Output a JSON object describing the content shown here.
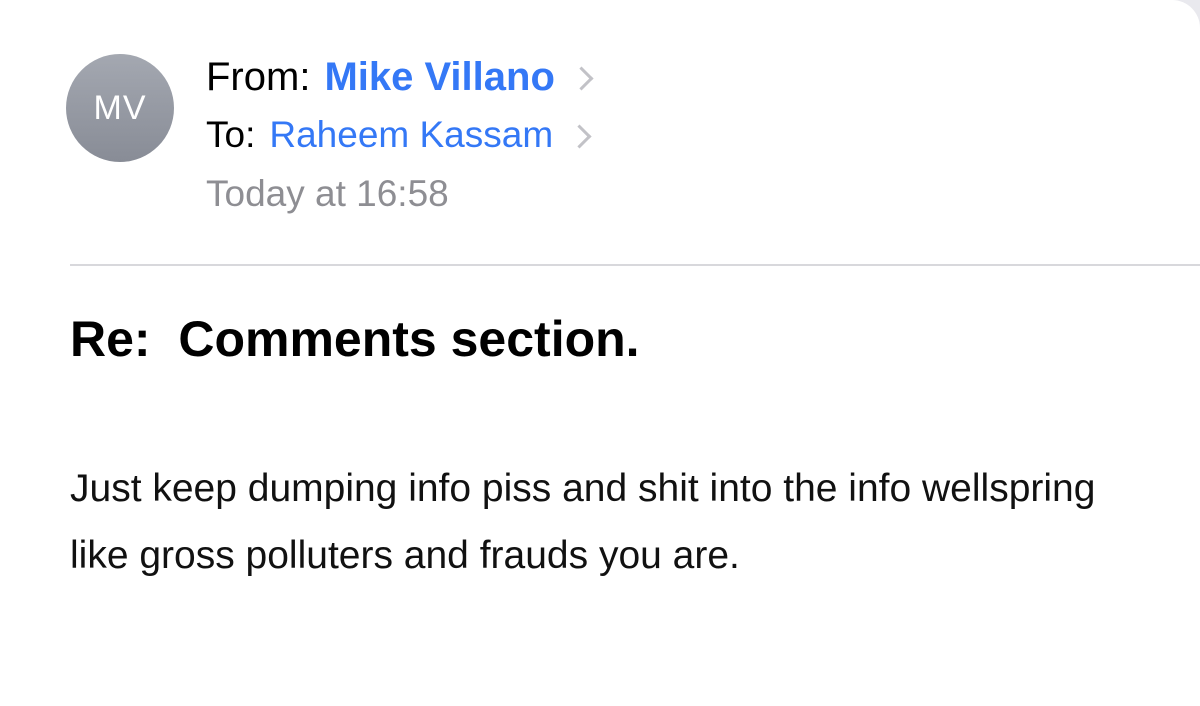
{
  "email": {
    "sender": {
      "initials": "MV",
      "from_label": "From:",
      "name": "Mike Villano"
    },
    "recipient": {
      "to_label": "To:",
      "name": "Raheem Kassam"
    },
    "date": "Today at 16:58",
    "subject": "Re:  Comments section.",
    "body": "Just keep dumping info piss and shit into the info wellspring like gross polluters and frauds you are."
  },
  "colors": {
    "link": "#3478f6",
    "secondary_text": "#8e8e93",
    "avatar": "#9a9ea7"
  },
  "icons": {
    "sender_chevron": "chevron-right-icon",
    "recipient_chevron": "chevron-right-icon"
  }
}
